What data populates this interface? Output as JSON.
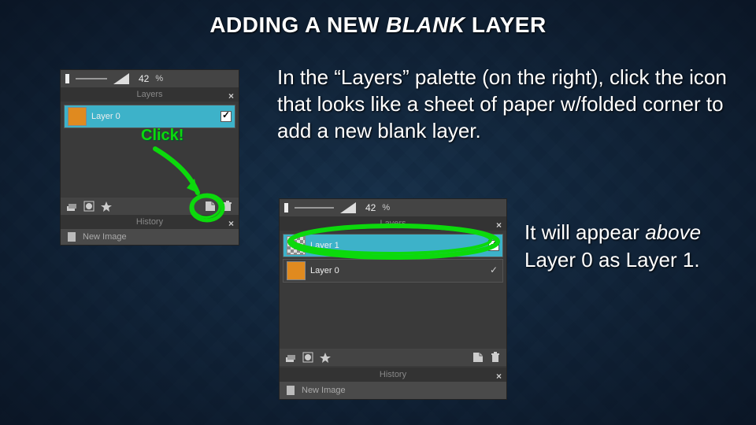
{
  "title": {
    "pre": "ADDING A NEW ",
    "em": "BLANK",
    "post": " LAYER"
  },
  "desc1": "In the “Layers” palette (on the right), click the icon that looks like a sheet of paper w/folded corner to add a new blank layer.",
  "desc2": {
    "t1": "It will appear ",
    "em": "above",
    "t2": " Layer 0 as Layer 1."
  },
  "panelA": {
    "opacity": "42",
    "pct": "%",
    "tab_layers": "Layers",
    "tab_history": "History",
    "layer0": "Layer 0",
    "new_image": "New Image"
  },
  "panelB": {
    "opacity": "42",
    "pct": "%",
    "tab_layers": "Layers",
    "tab_history": "History",
    "layer1": "Layer 1",
    "layer0": "Layer 0",
    "new_image": "New Image"
  },
  "annot": {
    "click": "Click!"
  }
}
